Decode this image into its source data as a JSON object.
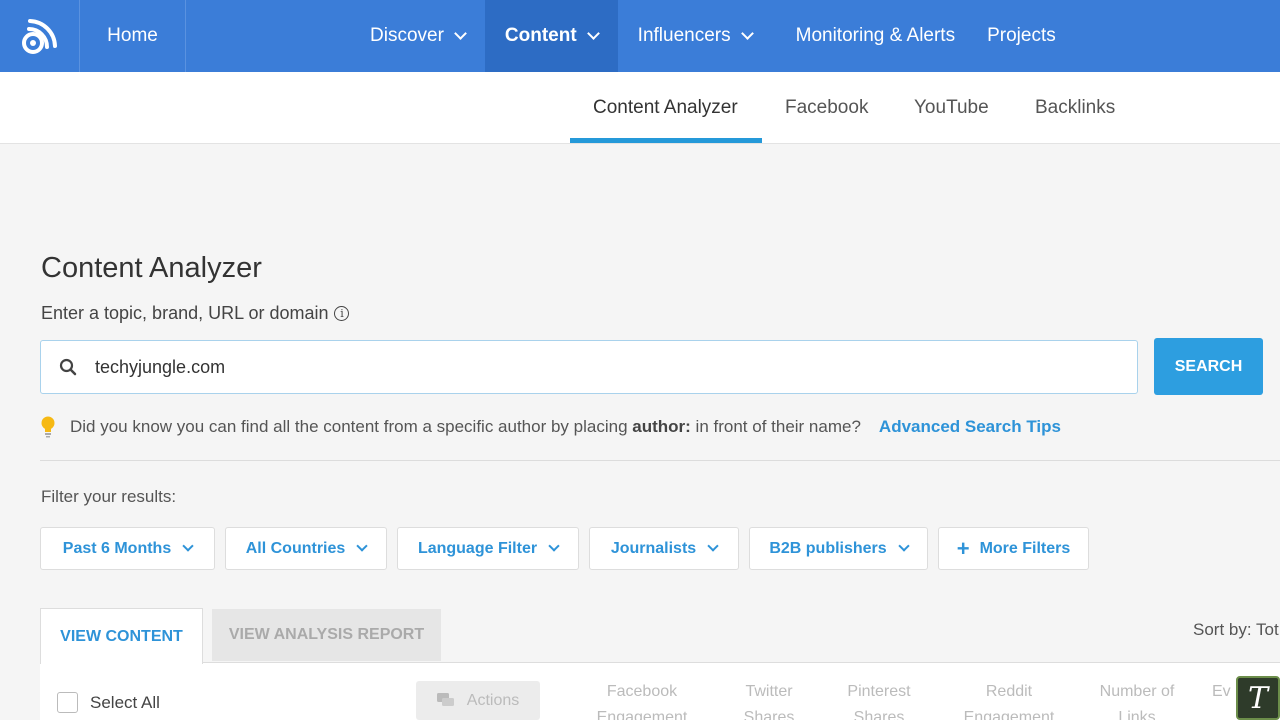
{
  "nav": {
    "home": "Home",
    "items": [
      {
        "label": "Discover",
        "dropdown": true,
        "active": false
      },
      {
        "label": "Content",
        "dropdown": true,
        "active": true
      },
      {
        "label": "Influencers",
        "dropdown": true,
        "active": false
      },
      {
        "label": "Monitoring & Alerts",
        "dropdown": false,
        "active": false
      },
      {
        "label": "Projects",
        "dropdown": false,
        "active": false
      }
    ]
  },
  "subnav": {
    "tabs": [
      "Content Analyzer",
      "Facebook",
      "YouTube",
      "Backlinks"
    ],
    "active": "Content Analyzer"
  },
  "main": {
    "title": "Content Analyzer",
    "prompt": "Enter a topic, brand, URL or domain",
    "search_value": "techyjungle.com",
    "search_button": "SEARCH",
    "tip_prefix": "Did you know you can find all the content from a specific author by placing",
    "tip_bold": "author:",
    "tip_suffix": "in front of their name?",
    "tip_link": "Advanced Search Tips",
    "filter_label": "Filter your results:",
    "filters": [
      "Past 6 Months",
      "All Countries",
      "Language Filter",
      "Journalists",
      "B2B publishers",
      "More Filters"
    ],
    "tabs": [
      "VIEW CONTENT",
      "VIEW ANALYSIS REPORT"
    ],
    "sort_by": "Sort by: Tot",
    "select_all": "Select All",
    "actions": "Actions",
    "columns": [
      "Facebook Engagement",
      "Twitter Shares",
      "Pinterest Shares",
      "Reddit Engagement",
      "Number of Links",
      "Ev"
    ]
  },
  "colors": {
    "nav_bg": "#3b7dd8",
    "nav_active": "#2d6cc4",
    "accent": "#2e93d8",
    "search_button": "#2d9ee0"
  },
  "badge": "T"
}
